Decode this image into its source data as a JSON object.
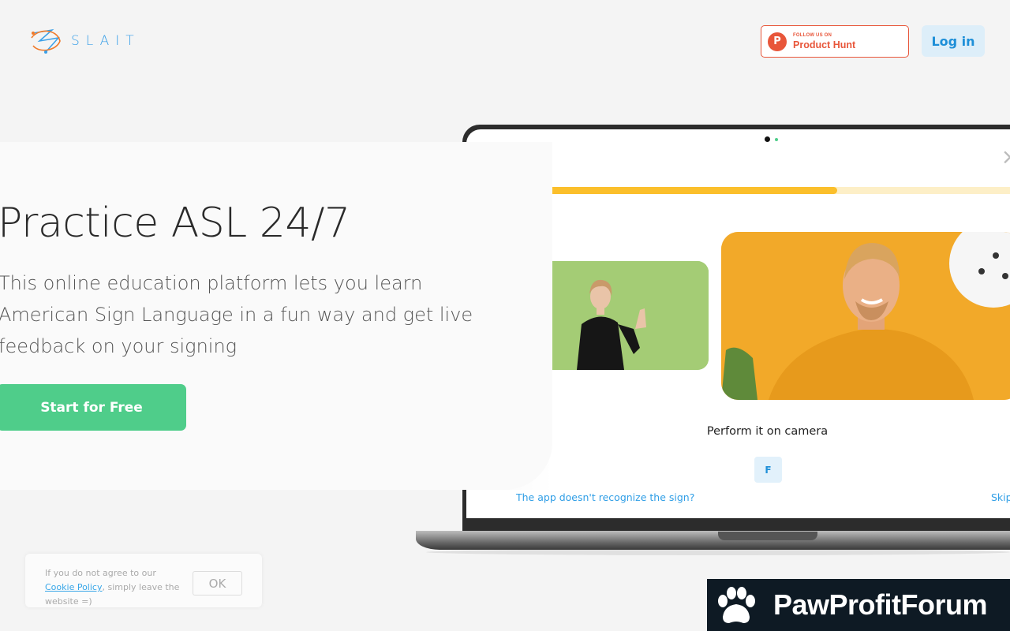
{
  "header": {
    "logo_text": "SLAIT",
    "product_hunt": {
      "small": "FOLLOW US ON",
      "big": "Product Hunt",
      "icon_letter": "P"
    },
    "login_label": "Log in"
  },
  "hero": {
    "title": "Practice ASL 24/7",
    "subtitle": "This online education platform lets you learn American Sign Language in a fun way and get live feedback on your signing",
    "cta_label": "Start for Free"
  },
  "app_preview": {
    "close_symbol": "×",
    "progress_fraction": 0.64,
    "prompt_text": "Perform it on camera",
    "letter": "F",
    "help_link": "The app doesn't recognize the sign?",
    "skip_link": "Skip"
  },
  "cookie": {
    "text_before": "If you do not agree to our ",
    "link_text": "Cookie Policy",
    "text_after": ", simply leave the website =)",
    "ok_label": "OK"
  },
  "watermark": {
    "text": "PawProfitForum"
  },
  "colors": {
    "accent_blue": "#1e8fd8",
    "cta_green": "#4fcd8a",
    "progress_yellow": "#fbbf2b",
    "product_hunt_red": "#e8563a"
  }
}
